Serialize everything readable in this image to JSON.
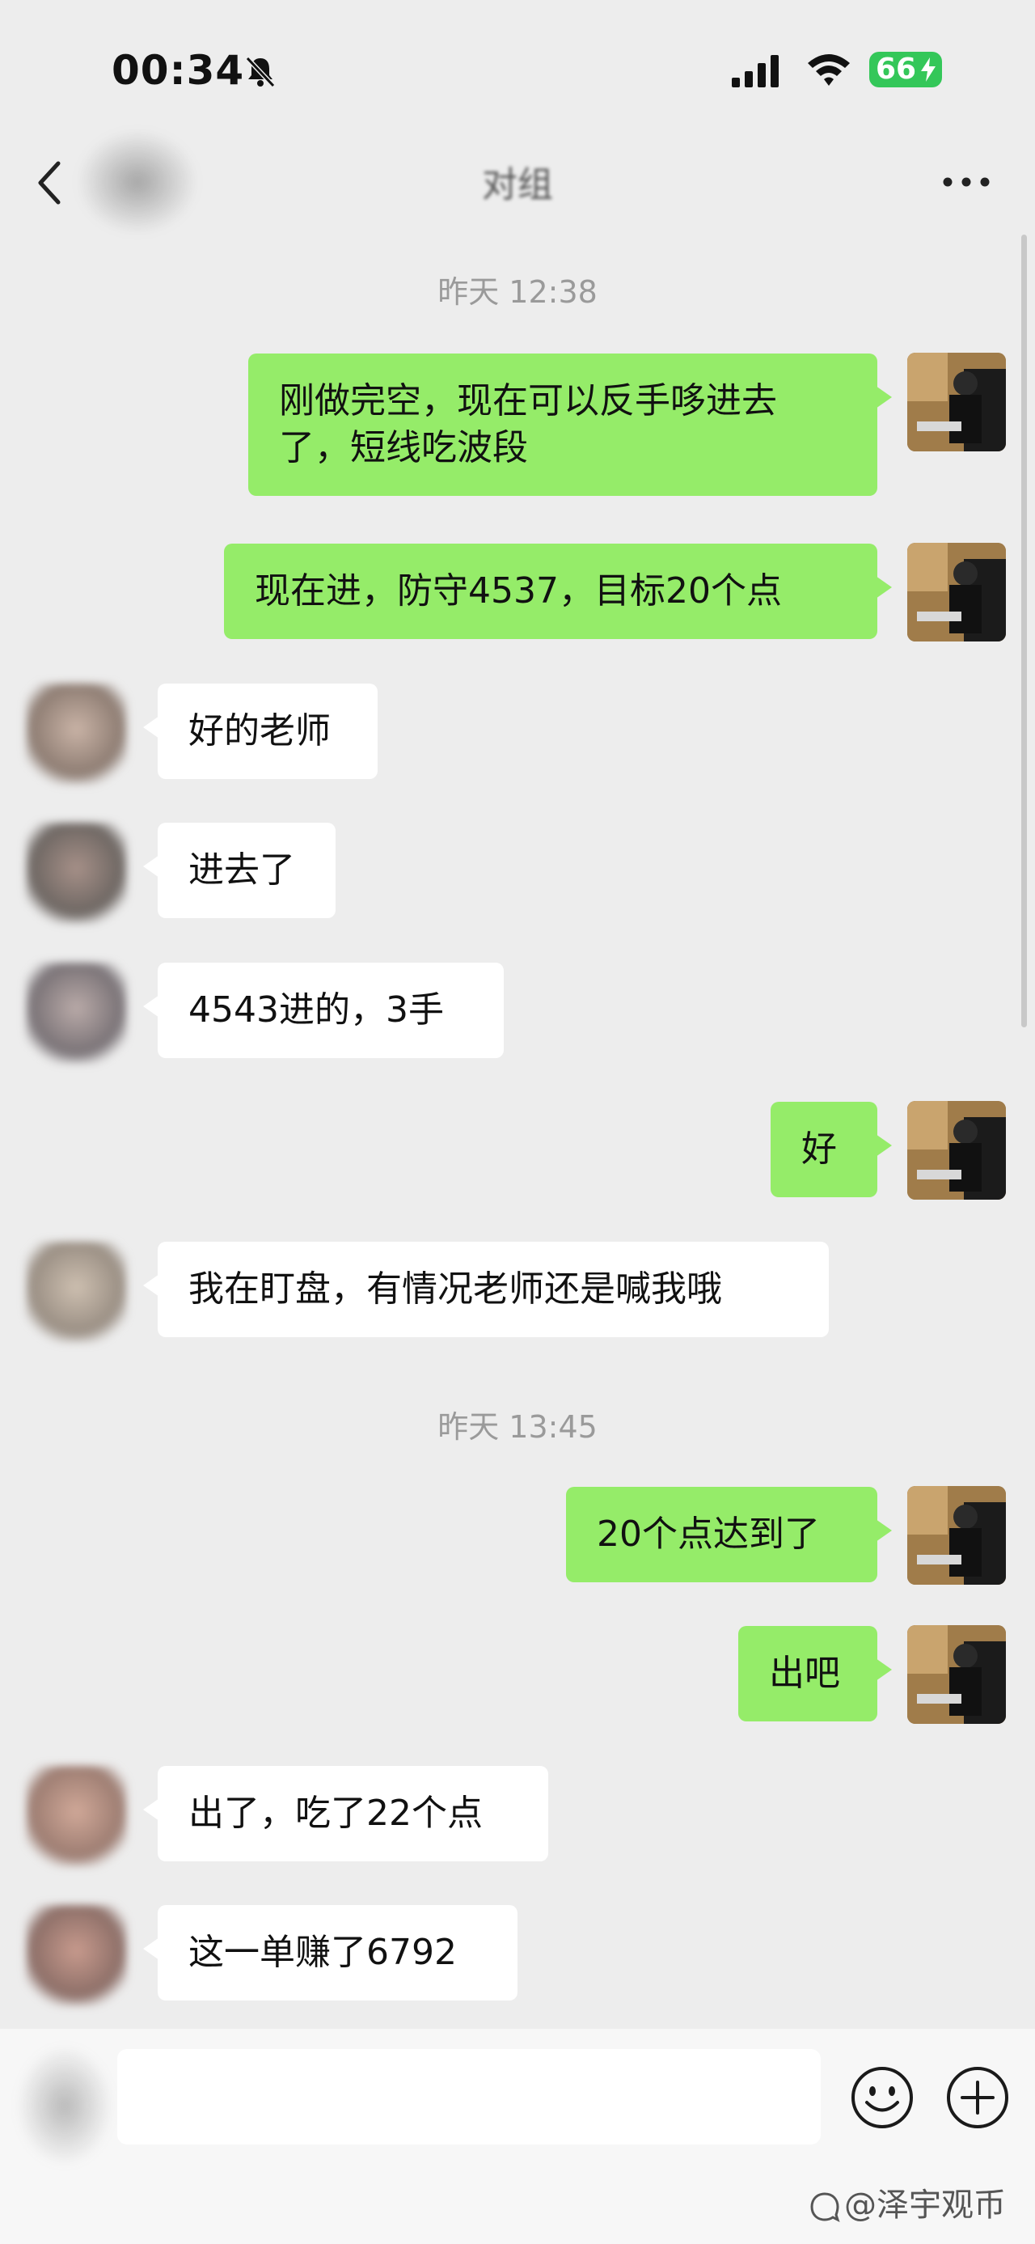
{
  "status_bar": {
    "time": "00:34",
    "battery": "66"
  },
  "nav": {
    "title": "对组"
  },
  "messages": [
    {
      "kind": "time",
      "text": "昨天 12:38"
    },
    {
      "kind": "me",
      "text": "刚做完空，现在可以反手哆进去了，短线吃波段"
    },
    {
      "kind": "me",
      "text": "现在进，防守4537，目标20个点"
    },
    {
      "kind": "them",
      "text": "好的老师"
    },
    {
      "kind": "them",
      "text": "进去了"
    },
    {
      "kind": "them",
      "text": "4543进的，3手"
    },
    {
      "kind": "me",
      "text": "好"
    },
    {
      "kind": "them",
      "text": "我在盯盘，有情况老师还是喊我哦"
    },
    {
      "kind": "time",
      "text": "昨天 13:45"
    },
    {
      "kind": "me",
      "text": "20个点达到了"
    },
    {
      "kind": "me",
      "text": "出吧"
    },
    {
      "kind": "them",
      "text": "出了，吃了22个点"
    },
    {
      "kind": "them",
      "text": "这一单赚了6792"
    }
  ],
  "input": {
    "placeholder": ""
  },
  "watermark": "@泽宇观币",
  "icons": [
    "bell-muted-icon",
    "signal-icon",
    "wifi-icon",
    "battery-icon",
    "back-icon",
    "more-icon",
    "emoji-icon",
    "plus-icon"
  ],
  "colors": {
    "background": "#ededed",
    "my_bubble": "#95ec69",
    "their_bubble": "#ffffff",
    "battery": "#34c759"
  }
}
